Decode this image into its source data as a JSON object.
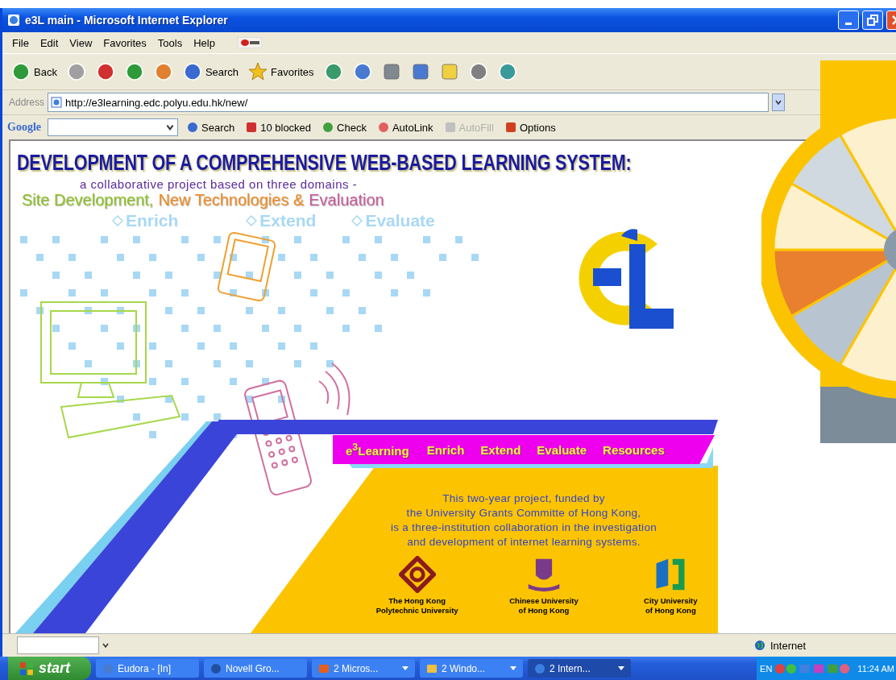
{
  "window": {
    "title": "e3L main - Microsoft Internet Explorer"
  },
  "menu": [
    "File",
    "Edit",
    "View",
    "Favorites",
    "Tools",
    "Help"
  ],
  "toolbar": [
    {
      "kind": "back",
      "label": "Back"
    },
    {
      "kind": "forward"
    },
    {
      "kind": "stop"
    },
    {
      "kind": "refresh"
    },
    {
      "kind": "home"
    },
    {
      "kind": "search",
      "label": "Search"
    },
    {
      "kind": "favorites",
      "label": "Favorites"
    },
    {
      "kind": "history"
    },
    {
      "kind": "mail"
    },
    {
      "kind": "print"
    },
    {
      "kind": "edit"
    },
    {
      "kind": "note"
    },
    {
      "kind": "messenger"
    },
    {
      "kind": "people"
    }
  ],
  "address": {
    "label": "Address",
    "url": "http://e3learning.edc.polyu.edu.hk/new/"
  },
  "google_toolbar": {
    "logo": "Google",
    "items": [
      {
        "kind": "search",
        "label": "Search",
        "disabled": false
      },
      {
        "kind": "blocked",
        "label": "10 blocked",
        "disabled": false
      },
      {
        "kind": "check",
        "label": "Check",
        "disabled": false
      },
      {
        "kind": "autolink",
        "label": "AutoLink",
        "disabled": false
      },
      {
        "kind": "autofill",
        "label": "AutoFill",
        "disabled": true
      },
      {
        "kind": "options",
        "label": "Options",
        "disabled": false
      }
    ]
  },
  "page": {
    "heading": "DEVELOPMENT OF A COMPREHENSIVE WEB-BASED LEARNING SYSTEM:",
    "subheading": "a collaborative project based on three domains -",
    "domains": [
      {
        "label": "Site Development,",
        "color": "#8cc020"
      },
      {
        "label": "New Technologies &",
        "color": "#f08a20"
      },
      {
        "label": "Evaluation",
        "color": "#c85a9a"
      }
    ],
    "sections": [
      "Enrich",
      "Extend",
      "Evaluate"
    ],
    "nav": [
      "e$^{3}$Learning",
      "Enrich",
      "Extend",
      "Evaluate",
      "Resources"
    ],
    "description": [
      "This two-year project, funded by",
      "the University Grants Committe of Hong Kong,",
      "is a three-institution collaboration in the investigation",
      "and development of internet learning systems."
    ],
    "institutions": [
      {
        "kind": "polyu",
        "name": [
          "The Hong Kong",
          "Polytechnic University"
        ]
      },
      {
        "kind": "cuhk",
        "name": [
          "Chinese University",
          "of Hong Kong"
        ]
      },
      {
        "kind": "cityu",
        "name": [
          "City University",
          "of Hong Kong"
        ]
      }
    ]
  },
  "status_bar": {
    "zone": "Internet"
  },
  "taskbar": {
    "start": "start",
    "tasks": [
      {
        "kind": "mail",
        "label": "Eudora - [In]",
        "grouped": false,
        "selected": false
      },
      {
        "kind": "globe",
        "label": "Novell Gro...",
        "grouped": false,
        "selected": false
      },
      {
        "kind": "slides",
        "label": "2 Micros...",
        "grouped": true,
        "selected": false
      },
      {
        "kind": "folder",
        "label": "2 Windo...",
        "grouped": true,
        "selected": false
      },
      {
        "kind": "browser",
        "label": "2 Intern...",
        "grouped": true,
        "selected": true
      }
    ],
    "language": "EN",
    "clock": "11:24 AM"
  }
}
